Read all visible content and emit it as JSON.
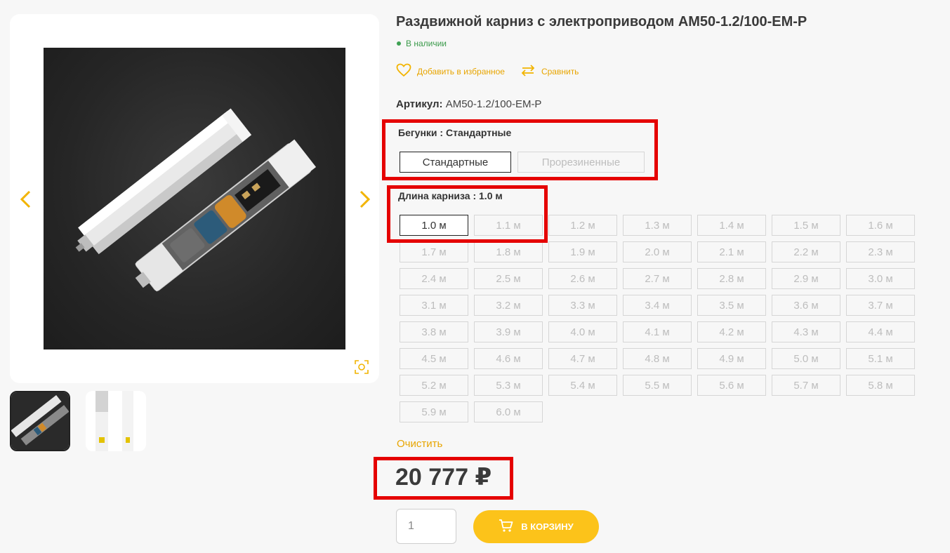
{
  "product": {
    "title": "Раздвижной карниз с электроприводом AM50-1.2/100-EM-P",
    "stock": "В наличии",
    "favorite_label": "Добавить в избранное",
    "compare_label": "Сравнить",
    "article_label": "Артикул:",
    "article_value": "AM50-1.2/100-EM-P",
    "clear_label": "Очистить",
    "price": "20 777 ₽",
    "quantity": "1",
    "cart_label": "В КОРЗИНУ"
  },
  "runners": {
    "label": "Бегунки : Стандартные",
    "options": [
      "Стандартные",
      "Прорезиненные"
    ],
    "selected": "Стандартные"
  },
  "length": {
    "label": "Длина карниза : 1.0 м",
    "options": [
      "1.0 м",
      "1.1 м",
      "1.2 м",
      "1.3 м",
      "1.4 м",
      "1.5 м",
      "1.6 м",
      "1.7 м",
      "1.8 м",
      "1.9 м",
      "2.0 м",
      "2.1 м",
      "2.2 м",
      "2.3 м",
      "2.4 м",
      "2.5 м",
      "2.6 м",
      "2.7 м",
      "2.8 м",
      "2.9 м",
      "3.0 м",
      "3.1 м",
      "3.2 м",
      "3.3 м",
      "3.4 м",
      "3.5 м",
      "3.6 м",
      "3.7 м",
      "3.8 м",
      "3.9 м",
      "4.0 м",
      "4.1 м",
      "4.2 м",
      "4.3 м",
      "4.4 м",
      "4.5 м",
      "4.6 м",
      "4.7 м",
      "4.8 м",
      "4.9 м",
      "5.0 м",
      "5.1 м",
      "5.2 м",
      "5.3 м",
      "5.4 м",
      "5.5 м",
      "5.6 м",
      "5.7 м",
      "5.8 м",
      "5.9 м",
      "6.0 м"
    ],
    "selected": "1.0 м"
  },
  "colors": {
    "accent": "#fcc31a",
    "link": "#e8a500",
    "in_stock": "#3fa154",
    "highlight": "#e50000"
  },
  "icons": [
    "chevron-left-icon",
    "chevron-right-icon",
    "zoom-icon",
    "heart-icon",
    "compare-arrows-icon",
    "cart-icon"
  ]
}
